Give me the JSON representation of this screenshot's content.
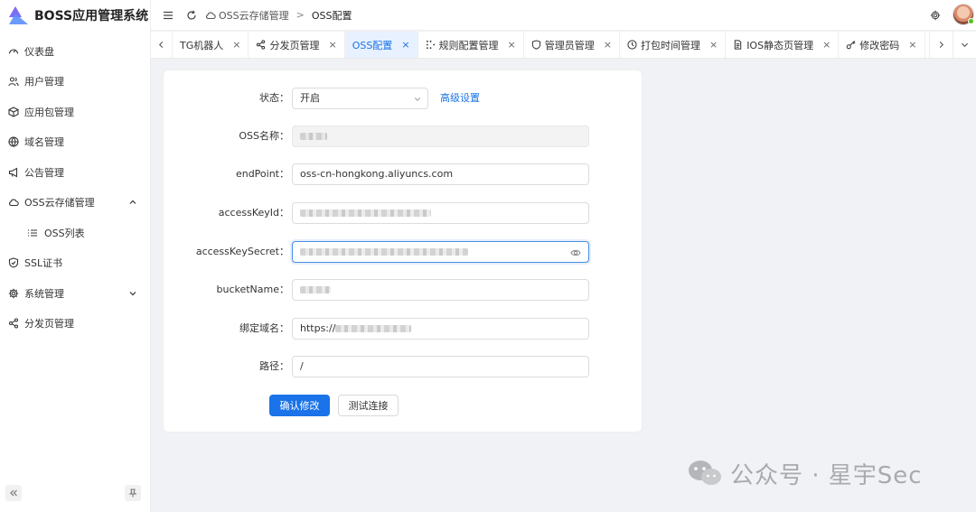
{
  "app": {
    "title": "BOSS应用管理系统"
  },
  "sidebar": {
    "items": [
      {
        "label": "仪表盘",
        "icon": "dashboard-icon"
      },
      {
        "label": "用户管理",
        "icon": "users-icon"
      },
      {
        "label": "应用包管理",
        "icon": "package-icon"
      },
      {
        "label": "域名管理",
        "icon": "globe-icon"
      },
      {
        "label": "公告管理",
        "icon": "megaphone-icon"
      },
      {
        "label": "OSS云存储管理",
        "icon": "cloud-icon",
        "expanded": true
      },
      {
        "label": "OSS列表",
        "icon": "list-icon",
        "sub": true
      },
      {
        "label": "SSL证书",
        "icon": "shield-icon"
      },
      {
        "label": "系统管理",
        "icon": "gear-icon",
        "expanded": false
      },
      {
        "label": "分发页管理",
        "icon": "share-icon"
      }
    ]
  },
  "header": {
    "breadcrumb": [
      "OSS云存储管理",
      "OSS配置"
    ],
    "separator": ">"
  },
  "tabs": {
    "items": [
      {
        "label": "TG机器人",
        "icon": ""
      },
      {
        "label": "分发页管理",
        "icon": "share-icon"
      },
      {
        "label": "OSS配置",
        "icon": "",
        "active": true
      },
      {
        "label": "规则配置管理",
        "icon": "rules-icon"
      },
      {
        "label": "管理员管理",
        "icon": "shield-icon"
      },
      {
        "label": "打包时间管理",
        "icon": "clock-icon"
      },
      {
        "label": "IOS静态页管理",
        "icon": "document-icon"
      },
      {
        "label": "修改密码",
        "icon": "key-icon"
      }
    ],
    "close_glyph": "×"
  },
  "form": {
    "status": {
      "label": "状态：",
      "value": "开启"
    },
    "advanced_link": "高级设置",
    "oss_name": {
      "label": "OSS名称："
    },
    "endpoint": {
      "label": "endPoint：",
      "value": "oss-cn-hongkong.aliyuncs.com"
    },
    "access_key_id": {
      "label": "accessKeyId："
    },
    "access_key_secret": {
      "label": "accessKeySecret："
    },
    "bucket_name": {
      "label": "bucketName："
    },
    "domain": {
      "label": "绑定域名：",
      "value_prefix": "https://"
    },
    "path": {
      "label": "路径：",
      "value": "/"
    },
    "confirm_button": "确认修改",
    "test_button": "测试连接"
  },
  "watermark": {
    "text": "公众号 · 星宇Sec"
  },
  "colors": {
    "accent": "#1a73e8",
    "active_tab_bg": "#e8f1ff",
    "page_bg": "#f0f2f5"
  }
}
